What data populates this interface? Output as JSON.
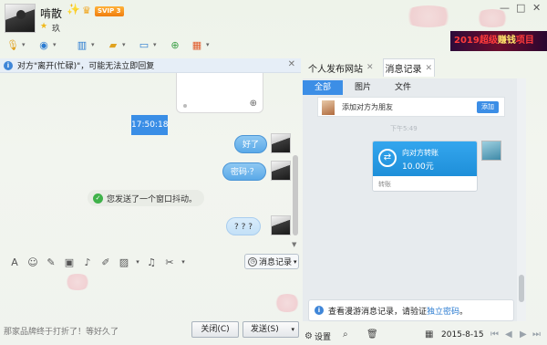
{
  "header": {
    "contact_name": "啃散",
    "vip_badge": "SVIP 3",
    "status_text": "玖",
    "banner_text": "2019超级",
    "banner_highlight": "赚钱",
    "banner_suffix": "项目"
  },
  "window_controls": {
    "minimize": "—",
    "maximize": "□",
    "close": "✕"
  },
  "toolbar": {
    "items": [
      "voice-call",
      "video-call",
      "remote-screen",
      "file-transfer",
      "share-screen",
      "create-group",
      "apps"
    ]
  },
  "notice": {
    "text": "对方\"离开(忙碌)\"，可能无法立即回复",
    "close": "✕"
  },
  "chat": {
    "timestamp": "17:50:18",
    "messages": [
      {
        "text": "好了",
        "style": "blue"
      },
      {
        "text": "密码·？",
        "style": "blue"
      },
      {
        "text": "? ? ?",
        "style": "light"
      }
    ],
    "system_note": "您发送了一个窗口抖动。"
  },
  "input_toolbar": {
    "message_record_label": "消息记录",
    "caret": "▾"
  },
  "footer": {
    "status_text": "那家品牌终于打折了！等好久了",
    "close_button": "关闭(C)",
    "send_button": "发送(S)",
    "send_caret": "▾"
  },
  "right_panel": {
    "tabs": [
      {
        "label": "个人发布网站",
        "active": false
      },
      {
        "label": "消息记录",
        "active": true
      }
    ],
    "tab_close": "✕",
    "subtabs": [
      {
        "label": "全部",
        "active": true
      },
      {
        "label": "图片",
        "active": false
      },
      {
        "label": "文件",
        "active": false
      }
    ],
    "friend_card_text": "添加对方为朋友",
    "friend_card_button": "添加",
    "separator_label": "下午5:49",
    "transfer": {
      "title": "向对方转账",
      "amount": "10.00元",
      "footer": "转账"
    },
    "tip_text": "查看漫游消息记录，请验证",
    "tip_link": "独立密码",
    "tip_suffix": "。",
    "settings_label": "设置",
    "date": "2015-8-15"
  },
  "colors": {
    "accent": "#3c8ee6",
    "bubble": "#5aa9e8",
    "banner_bg": "#4a0a30"
  }
}
